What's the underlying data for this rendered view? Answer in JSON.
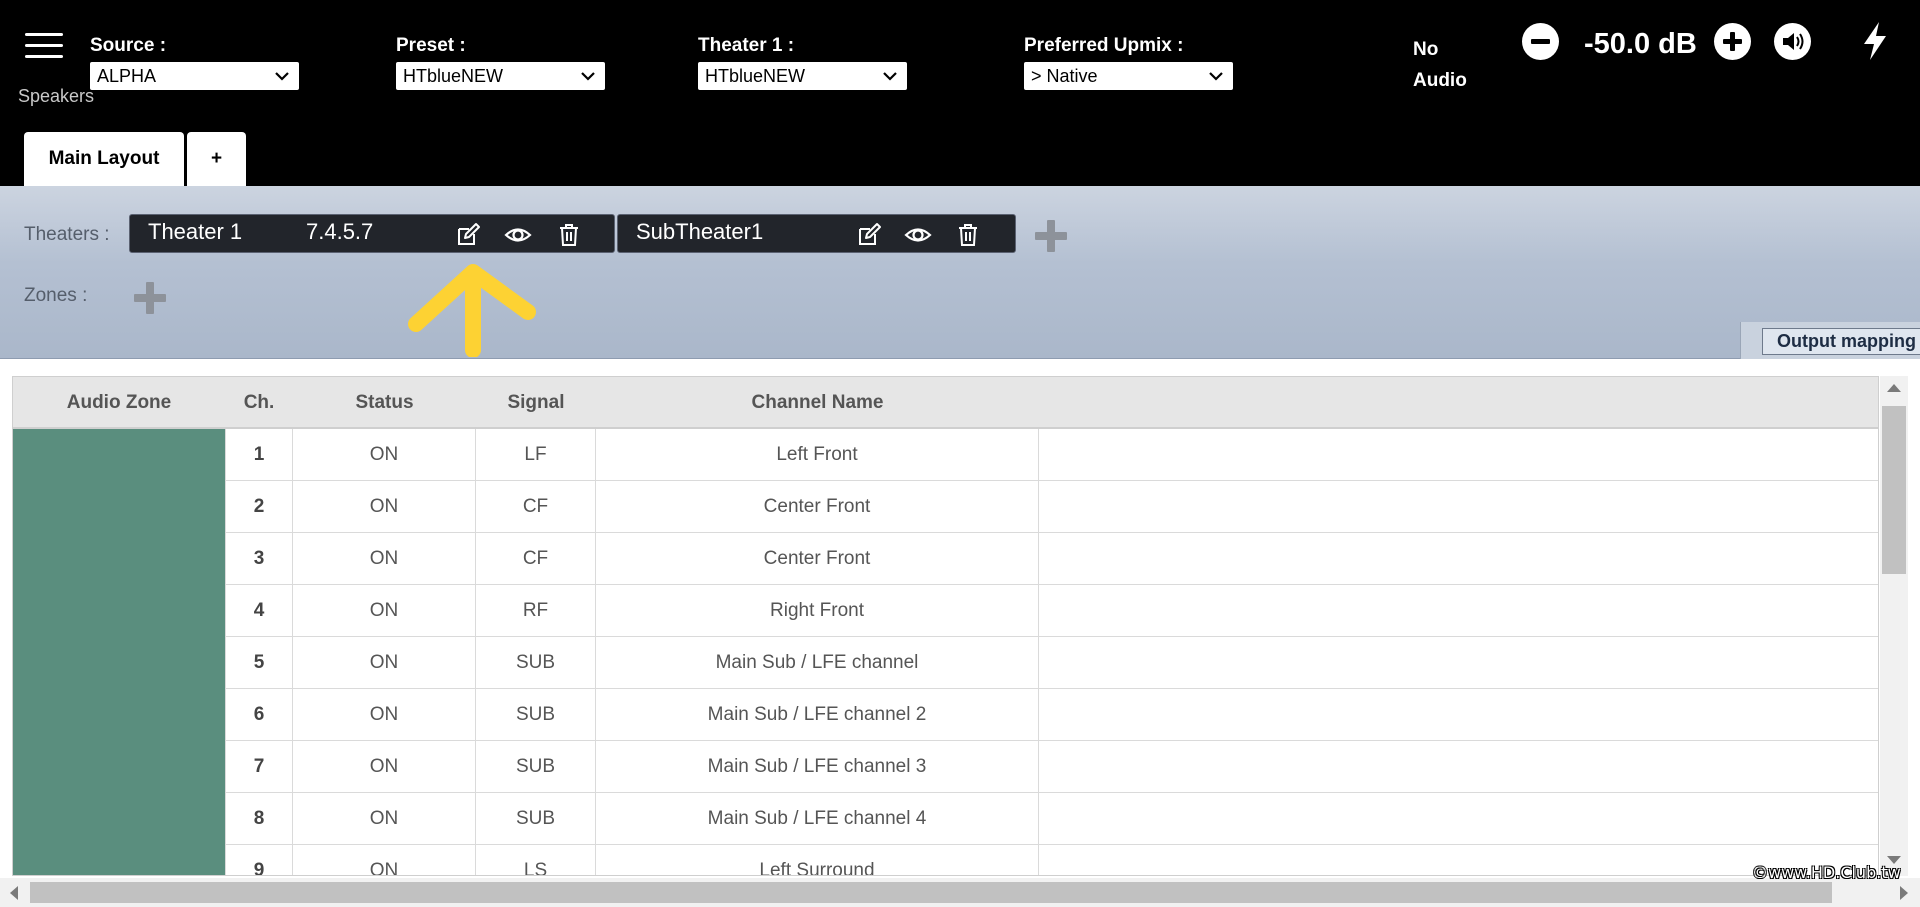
{
  "header": {
    "source": {
      "label": "Source :",
      "value": "ALPHA"
    },
    "preset": {
      "label": "Preset :",
      "value": "HTblueNEW"
    },
    "theater": {
      "label": "Theater 1 :",
      "value": "HTblueNEW"
    },
    "upmix": {
      "label": "Preferred Upmix :",
      "value": "> Native"
    },
    "page_label": "Speakers",
    "audio_status": "No Audio",
    "volume": "-50.0 dB"
  },
  "tabs": [
    {
      "label": "Main Layout",
      "active": true
    },
    {
      "label": "+"
    }
  ],
  "theaters": {
    "label": "Theaters :",
    "items": [
      {
        "name": "Theater 1",
        "format": "7.4.5.7"
      },
      {
        "name": "SubTheater1",
        "format": ""
      }
    ]
  },
  "zones": {
    "label": "Zones :"
  },
  "output_mapping": "Output mapping",
  "table": {
    "columns": [
      "Audio Zone",
      "Ch.",
      "Status",
      "Signal",
      "Channel Name"
    ],
    "rows": [
      {
        "ch": "1",
        "status": "ON",
        "signal": "LF",
        "name": "Left Front"
      },
      {
        "ch": "2",
        "status": "ON",
        "signal": "CF",
        "name": "Center Front"
      },
      {
        "ch": "3",
        "status": "ON",
        "signal": "CF",
        "name": "Center Front"
      },
      {
        "ch": "4",
        "status": "ON",
        "signal": "RF",
        "name": "Right Front"
      },
      {
        "ch": "5",
        "status": "ON",
        "signal": "SUB",
        "name": "Main Sub / LFE channel"
      },
      {
        "ch": "6",
        "status": "ON",
        "signal": "SUB",
        "name": "Main Sub / LFE channel 2"
      },
      {
        "ch": "7",
        "status": "ON",
        "signal": "SUB",
        "name": "Main Sub / LFE channel 3"
      },
      {
        "ch": "8",
        "status": "ON",
        "signal": "SUB",
        "name": "Main Sub / LFE channel 4"
      },
      {
        "ch": "9",
        "status": "ON",
        "signal": "LS",
        "name": "Left Surround"
      }
    ]
  },
  "colors": {
    "header_bg": "#000000",
    "zone_color": "#5a8e7e",
    "annotation_arrow": "#fdd233"
  },
  "watermark": "©www.HD.Club.tw"
}
